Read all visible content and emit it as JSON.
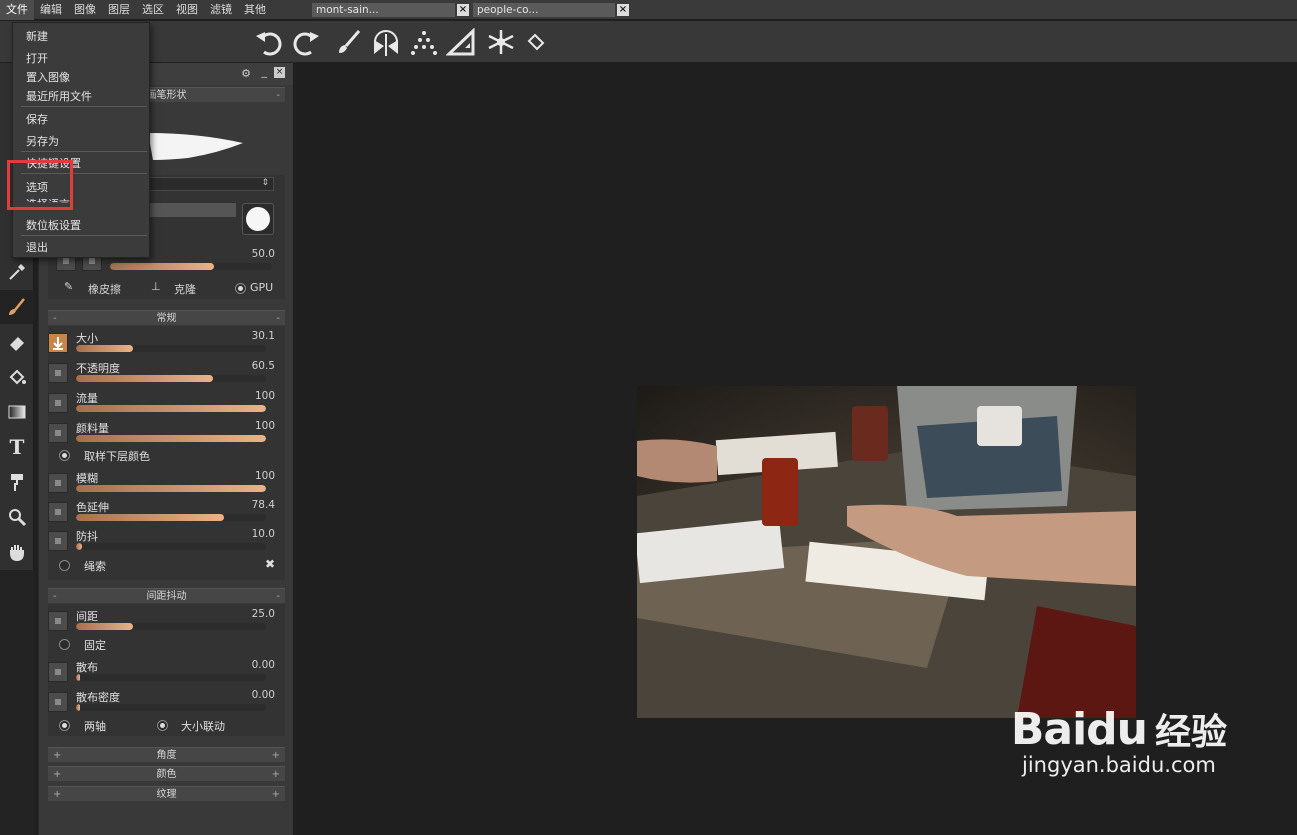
{
  "menubar": {
    "items": [
      "文件",
      "编辑",
      "图像",
      "图层",
      "选区",
      "视图",
      "滤镜",
      "其他"
    ],
    "doc_tabs": [
      "mont-sain...",
      "people-co..."
    ]
  },
  "file_menu": {
    "items": [
      "新建",
      "打开",
      "置入图像",
      "最近所用文件",
      "保存",
      "另存为",
      "快捷键设置",
      "选项",
      "选择语言",
      "数位板设置",
      "退出"
    ]
  },
  "brush_panel": {
    "top_section_label": "画笔形状",
    "top_slider_value": "50.0",
    "bottom_tools": {
      "eraser": "橡皮擦",
      "clone": "克隆",
      "gpu": "GPU"
    },
    "general": {
      "title": "常规",
      "sliders": [
        {
          "label": "大小",
          "value": "30.1",
          "level": 0.3
        },
        {
          "label": "不透明度",
          "value": "60.5",
          "level": 0.72
        },
        {
          "label": "流量",
          "value": "100",
          "level": 1.0
        },
        {
          "label": "颜料量",
          "value": "100",
          "level": 1.0
        }
      ],
      "sample_option": "取样下层颜色",
      "sliders2": [
        {
          "label": "模糊",
          "value": "100",
          "level": 1.0
        },
        {
          "label": "色延伸",
          "value": "78.4",
          "level": 0.78
        },
        {
          "label": "防抖",
          "value": "10.0",
          "level": 0.03
        }
      ],
      "lasso": "绳索"
    },
    "spacing": {
      "title": "间距抖动",
      "spacing": {
        "label": "间距",
        "value": "25.0",
        "level": 0.3
      },
      "fixed": "固定",
      "scatter": {
        "label": "散布",
        "value": "0.00",
        "level": 0.0
      },
      "scatter_density": {
        "label": "散布密度",
        "value": "0.00",
        "level": 0.0
      },
      "both_axes": "两轴",
      "size_link": "大小联动"
    },
    "collapsed_sections": [
      "角度",
      "颜色",
      "纹理"
    ]
  },
  "watermark": {
    "brand": "Baidu",
    "brand_cn": "经验",
    "url": "jingyan.baidu.com"
  },
  "colors": {
    "accent": "#c98447",
    "highlight": "#e03c3c"
  }
}
